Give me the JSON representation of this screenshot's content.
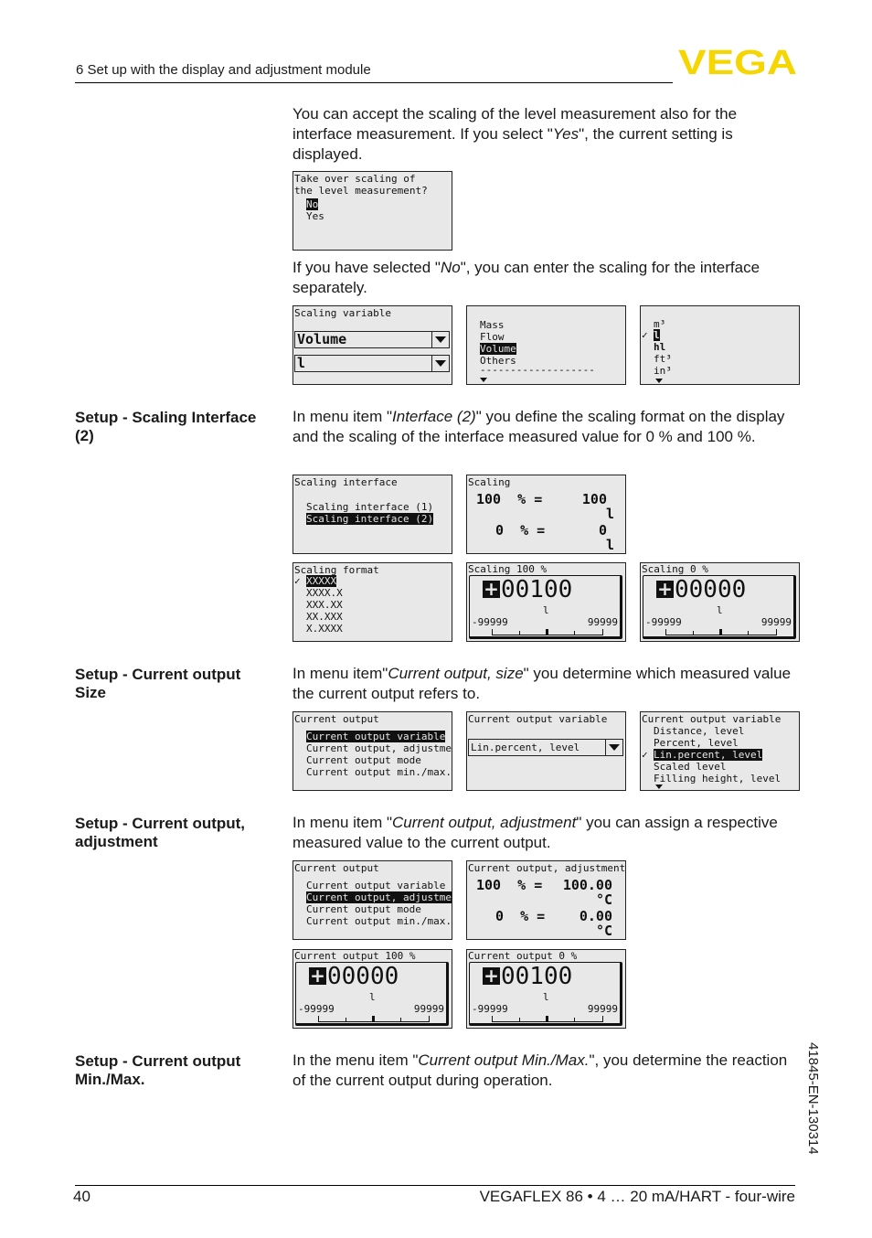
{
  "header": {
    "section_title": "6 Set up with the display and adjustment module",
    "logo_text": "VEGA",
    "logo_color": "#f5d600"
  },
  "footer": {
    "page_number": "40",
    "document_title": "VEGAFLEX 86 • 4 … 20 mA/HART - four-wire",
    "doc_code": "41845-EN-130314"
  },
  "intro": {
    "p1_a": "You can accept the scaling of the level measurement also for the interface measurement. If you select \"",
    "p1_em": "Yes",
    "p1_b": "\", the current setting is displayed.",
    "p2_a": "If you have selected \"",
    "p2_em": "No",
    "p2_b": "\", you can enter the scaling for the interface separately."
  },
  "sections": {
    "scaling_interface": {
      "heading": "Setup - Scaling Interface (2)",
      "text_a": "In menu item \"",
      "text_em": "Interface (2)",
      "text_b": "\" you define the scaling format on the display and the scaling of the interface measured value for 0 % and 100 %."
    },
    "current_size": {
      "heading": "Setup - Current output Size",
      "text_a": "In menu item\"",
      "text_em": "Current output, size",
      "text_b": "\" you determine which measured value the current output refers to."
    },
    "current_adjustment": {
      "heading": "Setup - Current output, adjustment",
      "text_a": "In menu item \"",
      "text_em": "Current output, adjustment",
      "text_b": "\" you can assign a respective measured value to the current output."
    },
    "current_minmax": {
      "heading": "Setup - Current output Min./Max.",
      "text_a": "In the menu item \"",
      "text_em": "Current output Min./Max.",
      "text_b": "\", you determine the reaction of the current output during operation."
    }
  },
  "displays": {
    "take_over": {
      "line1": "Take over scaling of",
      "line2": "the level measurement?",
      "options": [
        "No",
        "Yes"
      ],
      "selected": "No"
    },
    "scaling_variable": {
      "title": "Scaling variable",
      "value1": "Volume",
      "value2": "l"
    },
    "variable_list": {
      "options": [
        "Mass",
        "Flow",
        "Volume",
        "Others"
      ],
      "selected": "Volume",
      "separator": "-------------------"
    },
    "unit_list": {
      "options": [
        "m³",
        "l",
        "hl",
        "ft³",
        "in³"
      ],
      "selected": "l"
    },
    "scaling_interface_menu": {
      "title": "Scaling interface",
      "options": [
        "Scaling interface (1)",
        "Scaling interface (2)"
      ],
      "selected": "Scaling interface (2)"
    },
    "scaling_overview": {
      "title": "Scaling",
      "row1_pct": "100  % =",
      "row1_val": "100",
      "row1_unit": "l",
      "row2_pct": "0  % =",
      "row2_val": "0",
      "row2_unit": "l"
    },
    "scaling_format": {
      "title": "Scaling format",
      "options": [
        "XXXXX",
        "XXXX.X",
        "XXX.XX",
        "XX.XXX",
        "X.XXXX"
      ],
      "selected": "XXXXX"
    },
    "scaling_100": {
      "title": "Scaling 100 %",
      "sign": "+",
      "digits": "00100",
      "unit": "l",
      "min": "-99999",
      "max": "99999"
    },
    "scaling_0": {
      "title": "Scaling 0 %",
      "sign": "+",
      "digits": "00000",
      "unit": "l",
      "min": "-99999",
      "max": "99999"
    },
    "current_output_menu_1": {
      "title": "Current output",
      "options": [
        "Current output variable",
        "Current output, adjustment",
        "Current output mode",
        "Current output min./max."
      ],
      "selected": "Current output variable"
    },
    "current_output_variable": {
      "title": "Current output variable",
      "value": "Lin.percent, level"
    },
    "current_output_variable_list": {
      "title": "Current output variable",
      "options": [
        "Distance, level",
        "Percent, level",
        "Lin.percent, level",
        "Scaled level",
        "Filling height, level"
      ],
      "selected": "Lin.percent, level"
    },
    "current_output_menu_2": {
      "title": "Current output",
      "options": [
        "Current output variable",
        "Current output, adjustment",
        "Current output mode",
        "Current output min./max."
      ],
      "selected": "Current output, adjustment"
    },
    "current_adjustment_overview": {
      "title": "Current output, adjustment",
      "row1_pct": "100  % =",
      "row1_val": "100.00",
      "row1_unit": "°C",
      "row2_pct": "0  % =",
      "row2_val": "0.00",
      "row2_unit": "°C"
    },
    "current_100": {
      "title": "Current output 100 %",
      "sign": "+",
      "digits": "00000",
      "unit": "l",
      "min": "-99999",
      "max": "99999"
    },
    "current_0": {
      "title": "Current output 0 %",
      "sign": "+",
      "digits": "00100",
      "unit": "l",
      "min": "-99999",
      "max": "99999"
    }
  }
}
